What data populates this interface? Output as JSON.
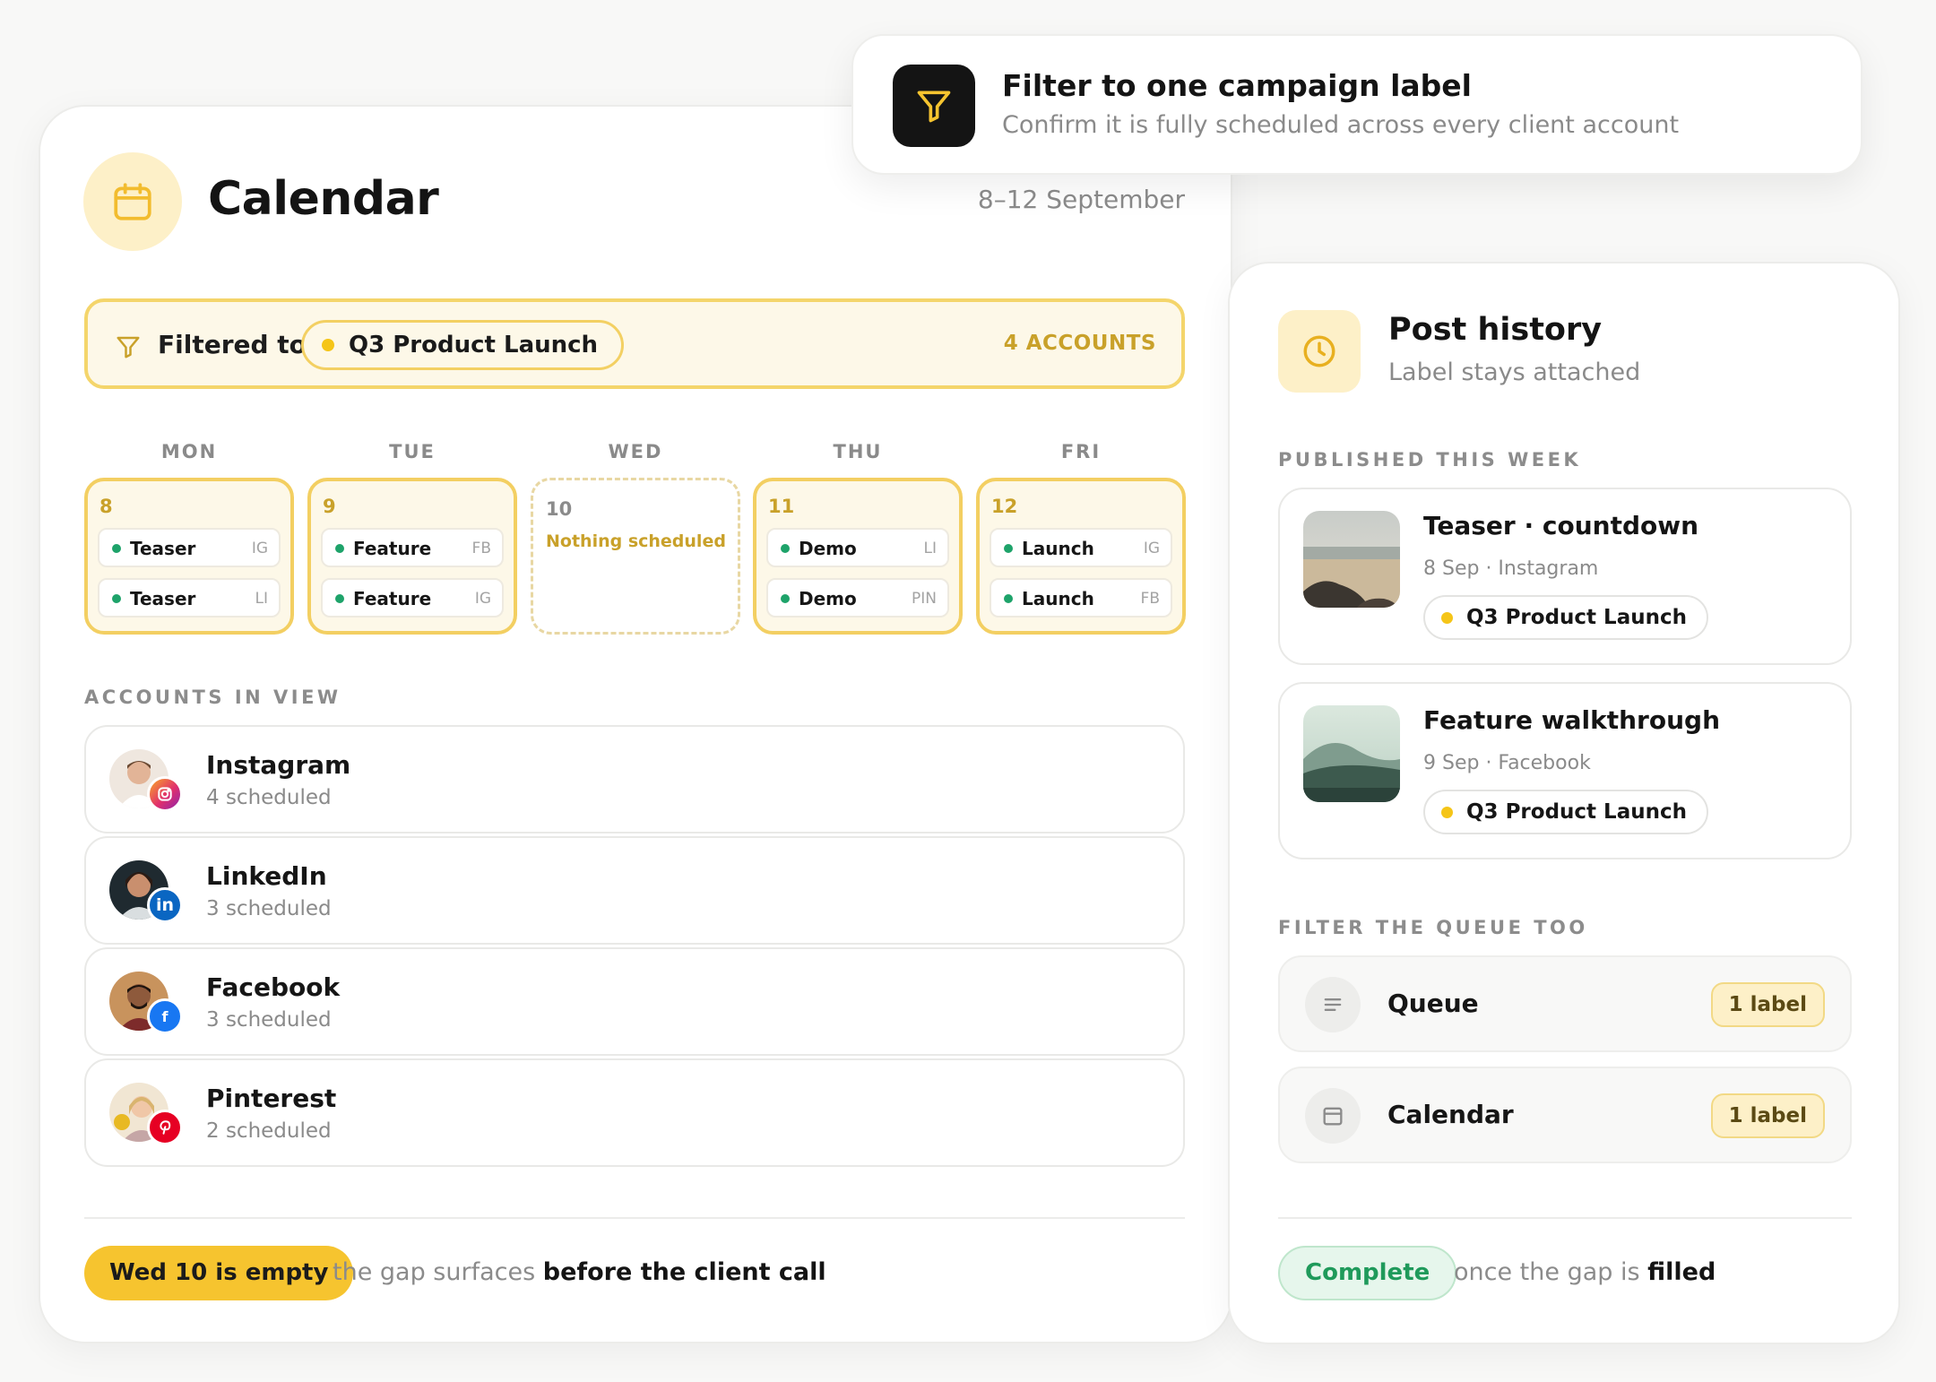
{
  "tooltip": {
    "icon": "filter-icon",
    "title": "Filter to one campaign label",
    "subtitle": "Confirm it is fully scheduled across every client account"
  },
  "calendar": {
    "icon": "calendar-icon",
    "title": "Calendar",
    "date_range": "8–12 September",
    "filter": {
      "prefix": "Filtered to",
      "label": "Q3 Product Launch",
      "count": "4 ACCOUNTS"
    },
    "days": [
      {
        "name": "MON",
        "num": "8",
        "posts": [
          {
            "name": "Teaser",
            "net": "IG"
          },
          {
            "name": "Teaser",
            "net": "LI"
          }
        ]
      },
      {
        "name": "TUE",
        "num": "9",
        "posts": [
          {
            "name": "Feature",
            "net": "FB"
          },
          {
            "name": "Feature",
            "net": "IG"
          }
        ]
      },
      {
        "name": "WED",
        "num": "10",
        "empty_text": "Nothing scheduled",
        "posts": []
      },
      {
        "name": "THU",
        "num": "11",
        "posts": [
          {
            "name": "Demo",
            "net": "LI"
          },
          {
            "name": "Demo",
            "net": "PIN"
          }
        ]
      },
      {
        "name": "FRI",
        "num": "12",
        "posts": [
          {
            "name": "Launch",
            "net": "IG"
          },
          {
            "name": "Launch",
            "net": "FB"
          }
        ]
      }
    ],
    "accounts_label": "ACCOUNTS IN VIEW",
    "accounts": [
      {
        "name": "Instagram",
        "sub": "4 scheduled",
        "badge_color": "#e1306c"
      },
      {
        "name": "LinkedIn",
        "sub": "3 scheduled",
        "badge_color": "#0a66c2"
      },
      {
        "name": "Facebook",
        "sub": "3 scheduled",
        "badge_color": "#1877f2"
      },
      {
        "name": "Pinterest",
        "sub": "2 scheduled",
        "badge_color": "#e60023"
      }
    ],
    "footer": {
      "pill": "Wed 10 is empty",
      "text_plain": "the gap surfaces",
      "text_bold": "before the client call"
    }
  },
  "history": {
    "icon": "clock-icon",
    "title": "Post history",
    "subtitle": "Label stays attached",
    "published_label": "PUBLISHED THIS WEEK",
    "published": [
      {
        "title": "Teaser · countdown",
        "meta": "8 Sep · Instagram",
        "label": "Q3 Product Launch"
      },
      {
        "title": "Feature walkthrough",
        "meta": "9 Sep · Facebook",
        "label": "Q3 Product Launch"
      }
    ],
    "queue_label": "FILTER THE QUEUE TOO",
    "queue": [
      {
        "name": "Queue",
        "badge": "1 label",
        "icon": "list-icon"
      },
      {
        "name": "Calendar",
        "badge": "1 label",
        "icon": "calendar-icon"
      }
    ],
    "footer": {
      "pill": "Complete",
      "text_plain": "once the gap is",
      "text_bold": "filled"
    }
  },
  "colors": {
    "accent_yellow": "#f6c42f",
    "accent_soft": "#fdf0c8",
    "scheduled_dot": "#1ea36a",
    "label_dot": "#f5c518",
    "complete_green": "#1f9a5b"
  }
}
